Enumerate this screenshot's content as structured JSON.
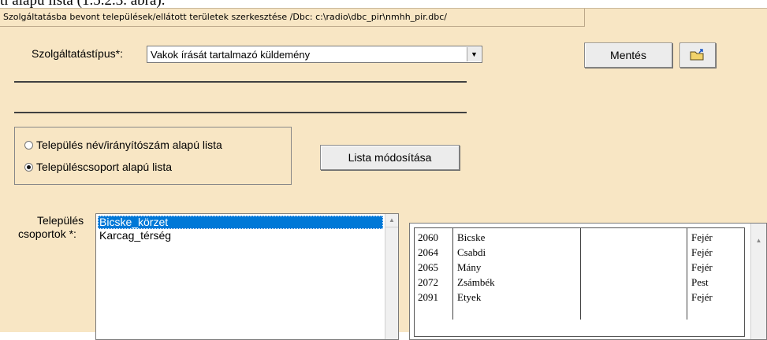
{
  "doc_fragment": "ti alapú lista (1.5.2.3. ábra).",
  "title": "Szolgáltatásba bevont települések/ellátott területek szerkesztése   /Dbc: c:\\radio\\dbc_pir\\nmhh_pir.dbc/",
  "service_type": {
    "label": "Szolgáltatástípus*:",
    "value": "Vakok írását tartalmazó küldemény"
  },
  "buttons": {
    "save": "Mentés",
    "modify_list": "Lista módosítása"
  },
  "radios": [
    {
      "label": "Település név/irányítószám alapú lista",
      "checked": false
    },
    {
      "label": "Településcsoport alapú lista",
      "checked": true
    }
  ],
  "groups": {
    "label_line1": "Település",
    "label_line2": "csoportok *:",
    "items": [
      "Bicske_körzet",
      "Karcag_térség"
    ],
    "selected_index": 0
  },
  "settlements": {
    "rows": [
      {
        "zip": "2060",
        "name": "Bicske",
        "extra": "",
        "county": "Fejér"
      },
      {
        "zip": "2064",
        "name": "Csabdi",
        "extra": "",
        "county": "Fejér"
      },
      {
        "zip": "2065",
        "name": "Mány",
        "extra": "",
        "county": "Fejér"
      },
      {
        "zip": "2072",
        "name": "Zsámbék",
        "extra": "",
        "county": "Pest"
      },
      {
        "zip": "2091",
        "name": "Etyek",
        "extra": "",
        "county": "Fejér"
      }
    ]
  }
}
